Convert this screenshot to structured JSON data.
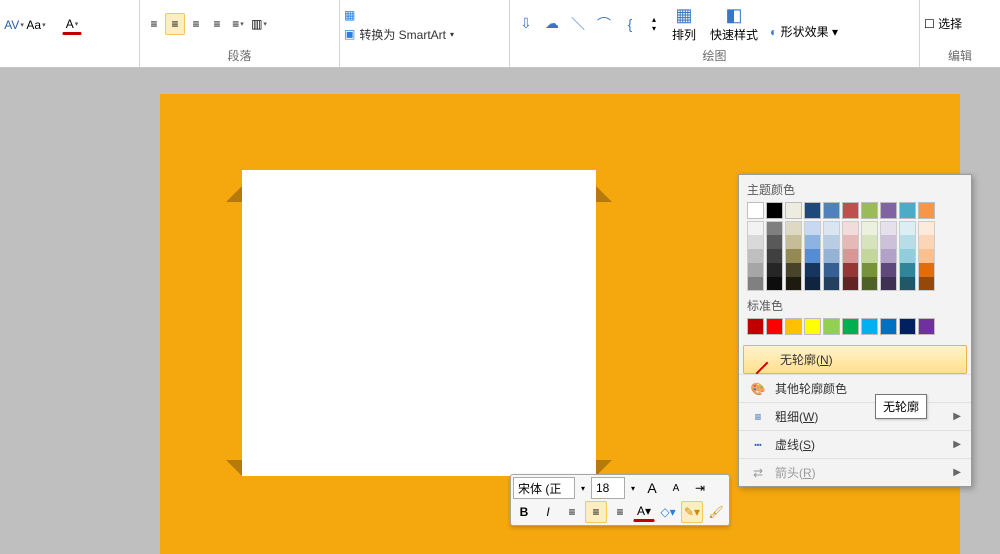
{
  "ribbon": {
    "groups": {
      "paragraph": {
        "label": "段落"
      },
      "smartart": {
        "convert_label": "转换为 SmartArt"
      },
      "drawing": {
        "label": "绘图",
        "arrange": "排列",
        "quick_styles": "快速样式",
        "shape_effects": "形状效果"
      },
      "editing": {
        "label": "编辑",
        "select": "选择"
      }
    },
    "font_buttons": {
      "spacing": "AV",
      "case": "Aa",
      "color": "A"
    }
  },
  "mini_toolbar": {
    "font_name": "宋体 (正",
    "font_size": "18",
    "grow": "A",
    "shrink": "A",
    "bold": "B",
    "italic": "I"
  },
  "outline_popup": {
    "theme_heading": "主题颜色",
    "standard_heading": "标准色",
    "no_outline": "无轮廓(N)",
    "more_colors": "其他轮廓颜色",
    "weight": "粗细(W)",
    "dashes": "虚线(S)",
    "arrows": "箭头(R)",
    "tooltip": "无轮廓",
    "theme_colors": [
      "#ffffff",
      "#000000",
      "#eeece1",
      "#1f497d",
      "#4f81bd",
      "#c0504d",
      "#9bbb59",
      "#8064a2",
      "#4bacc6",
      "#f79646"
    ],
    "theme_shades": [
      [
        "#f2f2f2",
        "#d9d9d9",
        "#bfbfbf",
        "#a6a6a6",
        "#808080"
      ],
      [
        "#7f7f7f",
        "#595959",
        "#404040",
        "#262626",
        "#0d0d0d"
      ],
      [
        "#ddd9c3",
        "#c4bd97",
        "#948a54",
        "#494429",
        "#1d1b10"
      ],
      [
        "#c6d9f0",
        "#8db3e2",
        "#548dd4",
        "#17365d",
        "#0f243e"
      ],
      [
        "#dbe5f1",
        "#b8cce4",
        "#95b3d7",
        "#366092",
        "#244061"
      ],
      [
        "#f2dcdb",
        "#e5b9b7",
        "#d99694",
        "#953734",
        "#632423"
      ],
      [
        "#ebf1dd",
        "#d7e3bc",
        "#c3d69b",
        "#76923c",
        "#4f6128"
      ],
      [
        "#e5e0ec",
        "#ccc1d9",
        "#b2a2c7",
        "#5f497a",
        "#3f3151"
      ],
      [
        "#dbeef3",
        "#b7dde8",
        "#92cddc",
        "#31859b",
        "#205867"
      ],
      [
        "#fdeada",
        "#fbd5b5",
        "#fac08f",
        "#e36c09",
        "#974806"
      ]
    ],
    "standard_colors": [
      "#c00000",
      "#ff0000",
      "#ffc000",
      "#ffff00",
      "#92d050",
      "#00b050",
      "#00b0f0",
      "#0070c0",
      "#002060",
      "#7030a0"
    ]
  }
}
